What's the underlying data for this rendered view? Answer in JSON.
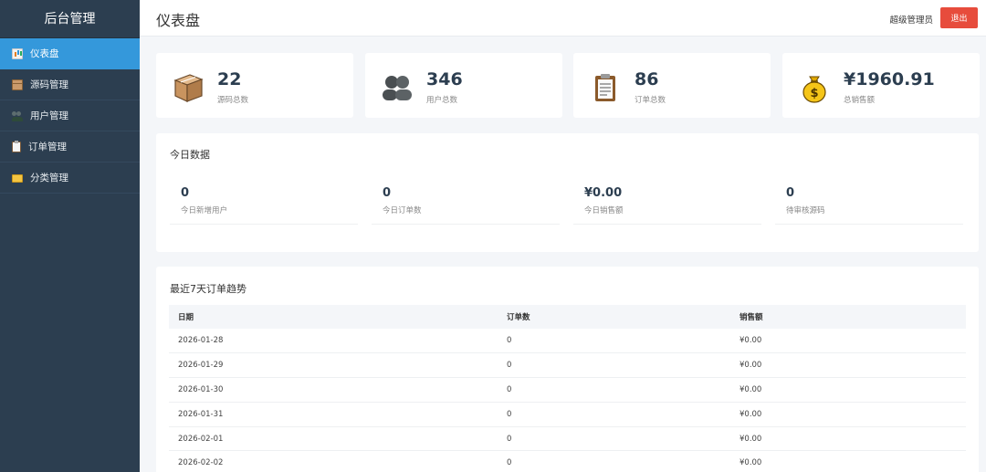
{
  "sidebar": {
    "title": "后台管理",
    "items": [
      {
        "label": "仪表盘",
        "icon": "chart-icon",
        "active": true
      },
      {
        "label": "源码管理",
        "icon": "box-icon",
        "active": false
      },
      {
        "label": "用户管理",
        "icon": "users-icon",
        "active": false
      },
      {
        "label": "订单管理",
        "icon": "clipboard-icon",
        "active": false
      },
      {
        "label": "分类管理",
        "icon": "folder-icon",
        "active": false
      }
    ]
  },
  "header": {
    "title": "仪表盘",
    "admin_name": "超级管理员",
    "logout_label": "退出"
  },
  "stats": [
    {
      "value": "22",
      "label": "源码总数",
      "icon": "package-box-icon"
    },
    {
      "value": "346",
      "label": "用户总数",
      "icon": "users-icon"
    },
    {
      "value": "86",
      "label": "订单总数",
      "icon": "clipboard-icon"
    },
    {
      "value": "¥1960.91",
      "label": "总销售额",
      "icon": "money-bag-icon"
    }
  ],
  "today": {
    "title": "今日数据",
    "items": [
      {
        "value": "0",
        "label": "今日新增用户"
      },
      {
        "value": "0",
        "label": "今日订单数"
      },
      {
        "value": "¥0.00",
        "label": "今日销售额"
      },
      {
        "value": "0",
        "label": "待审核源码"
      }
    ]
  },
  "trend": {
    "title": "最近7天订单趋势",
    "columns": [
      "日期",
      "订单数",
      "销售额"
    ],
    "rows": [
      [
        "2026-01-28",
        "0",
        "¥0.00"
      ],
      [
        "2026-01-29",
        "0",
        "¥0.00"
      ],
      [
        "2026-01-30",
        "0",
        "¥0.00"
      ],
      [
        "2026-01-31",
        "0",
        "¥0.00"
      ],
      [
        "2026-02-01",
        "0",
        "¥0.00"
      ],
      [
        "2026-02-02",
        "0",
        "¥0.00"
      ]
    ]
  },
  "colors": {
    "sidebar_bg": "#2c3e50",
    "active_blue": "#3498db",
    "logout_red": "#e74c3c"
  }
}
